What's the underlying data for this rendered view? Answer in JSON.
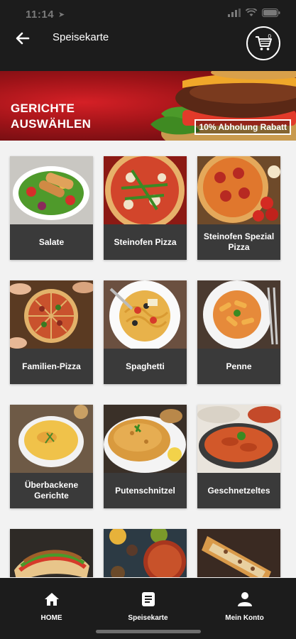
{
  "status_bar": {
    "time": "11:14"
  },
  "header": {
    "title": "Speisekarte",
    "cart_count": "0"
  },
  "banner": {
    "heading_line1": "GERICHTE",
    "heading_line2": "AUSWÄHLEN",
    "badge": "10% Abholung Rabatt"
  },
  "categories": [
    {
      "label": "Salate",
      "image": "salad-bowl"
    },
    {
      "label": "Steinofen Pizza",
      "image": "pizza-arugula"
    },
    {
      "label": "Steinofen Spezial Pizza",
      "image": "pizza-salami-tomatoes"
    },
    {
      "label": "Familien-Pizza",
      "image": "pizza-sliced-hands"
    },
    {
      "label": "Spaghetti",
      "image": "spaghetti-plate"
    },
    {
      "label": "Penne",
      "image": "penne-plate"
    },
    {
      "label": "Überbackene Gerichte",
      "image": "gratin-dish"
    },
    {
      "label": "Putenschnitzel",
      "image": "schnitzel"
    },
    {
      "label": "Geschnetzeltes",
      "image": "curry-pan"
    },
    {
      "label": "",
      "image": "doner-wrap"
    },
    {
      "label": "",
      "image": "spice-bowls"
    },
    {
      "label": "",
      "image": "turkish-pide"
    }
  ],
  "bottom_nav": [
    {
      "label": "HOME",
      "icon": "home-icon"
    },
    {
      "label": "Speisekarte",
      "icon": "menu-list-icon"
    },
    {
      "label": "Mein Konto",
      "icon": "user-icon"
    }
  ],
  "colors": {
    "bar_background": "#1c1c1c",
    "label_background": "#3a3a3a",
    "banner_red": "#c41a20",
    "page_background": "#f2f2f2"
  }
}
